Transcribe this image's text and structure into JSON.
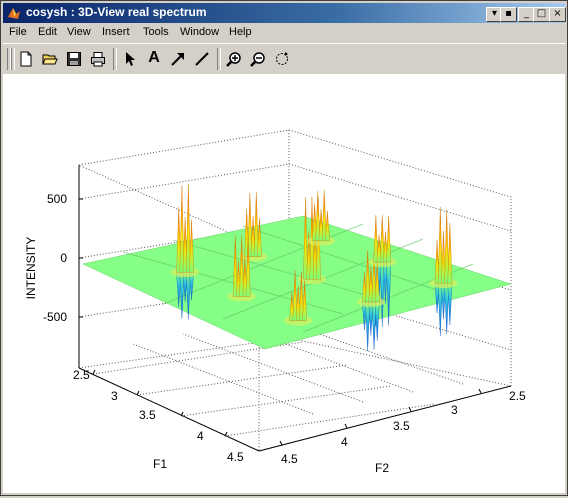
{
  "window": {
    "title": "cosysh : 3D-View real spectrum"
  },
  "menu": [
    "File",
    "Edit",
    "View",
    "Insert",
    "Tools",
    "Window",
    "Help"
  ],
  "toolbar": {
    "text_tool_glyph": "A",
    "tools": [
      "new-file-icon",
      "open-folder-icon",
      "save-icon",
      "print-icon",
      "pointer-arrow-icon",
      "insert-text-icon",
      "arrow-icon",
      "line-icon",
      "zoom-in-icon",
      "zoom-out-icon",
      "rotate-icon"
    ]
  },
  "plot": {
    "zlabel": "INTENSITY",
    "xlabel": "F1",
    "ylabel": "F2",
    "zticks": [
      "500",
      "0",
      "-500"
    ],
    "f1_ticks": [
      "2.5",
      "3",
      "3.5",
      "4",
      "4.5"
    ],
    "f2_ticks": [
      "4.5",
      "4",
      "3.5",
      "3",
      "2.5"
    ],
    "colors": {
      "low": "#1f7ff0",
      "base": "#7cff78",
      "mid": "#ffe000",
      "high": "#e02000"
    }
  },
  "chart_data": {
    "type": "surface",
    "xlabel": "F1",
    "ylabel": "F2",
    "zlabel": "INTENSITY",
    "xlim": [
      2.5,
      4.5
    ],
    "ylim": [
      2.5,
      4.5
    ],
    "zlim": [
      -750,
      750
    ],
    "peaks": [
      {
        "f1": 3.0,
        "f2": 3.0,
        "intensity": 750
      },
      {
        "f1": 3.6,
        "f2": 3.6,
        "intensity": 700
      },
      {
        "f1": 4.2,
        "f2": 4.2,
        "intensity": 650
      },
      {
        "f1": 3.0,
        "f2": 4.2,
        "intensity": 430
      },
      {
        "f1": 4.2,
        "f2": 3.0,
        "intensity": 430
      },
      {
        "f1": 3.0,
        "f2": 3.6,
        "intensity": 550
      },
      {
        "f1": 3.6,
        "f2": 3.0,
        "intensity": 520
      },
      {
        "f1": 4.2,
        "f2": 3.6,
        "intensity": 440
      },
      {
        "f1": 3.6,
        "f2": 4.2,
        "intensity": 400
      },
      {
        "f1": 3.0,
        "f2": 3.0,
        "intensity": -400
      },
      {
        "f1": 4.2,
        "f2": 4.2,
        "intensity": -450
      },
      {
        "f1": 3.6,
        "f2": 4.2,
        "intensity": -550
      },
      {
        "f1": 4.2,
        "f2": 3.6,
        "intensity": -420
      }
    ]
  }
}
